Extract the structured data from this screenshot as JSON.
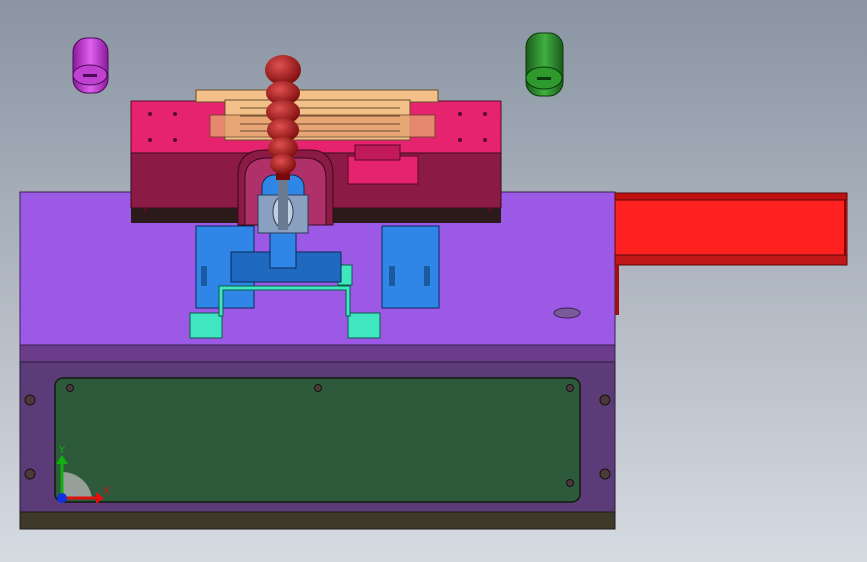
{
  "viewport": {
    "background_top": "#8a94a2",
    "background_bottom": "#d6dbe2"
  },
  "axes": {
    "x_label": "X",
    "y_label": "Y",
    "x_color": "#e01010",
    "y_color": "#10b010",
    "z_color": "#1030e0"
  },
  "colors": {
    "base_plate": "#9b59e6",
    "base_side": "#6a3c8a",
    "front_panel": "#5b3c78",
    "green_panel": "#2d5a3a",
    "magenta_block": "#e6236e",
    "dark_magenta": "#8b1a44",
    "blue_parts": "#2f86e6",
    "red_tray": "#ff2020",
    "handle_red": "#b01818",
    "cylinder_purple": "#d040e0",
    "cylinder_green": "#2e9a2e",
    "peach_parts": "#f4c08a",
    "cyan_brackets": "#40e6c0"
  }
}
